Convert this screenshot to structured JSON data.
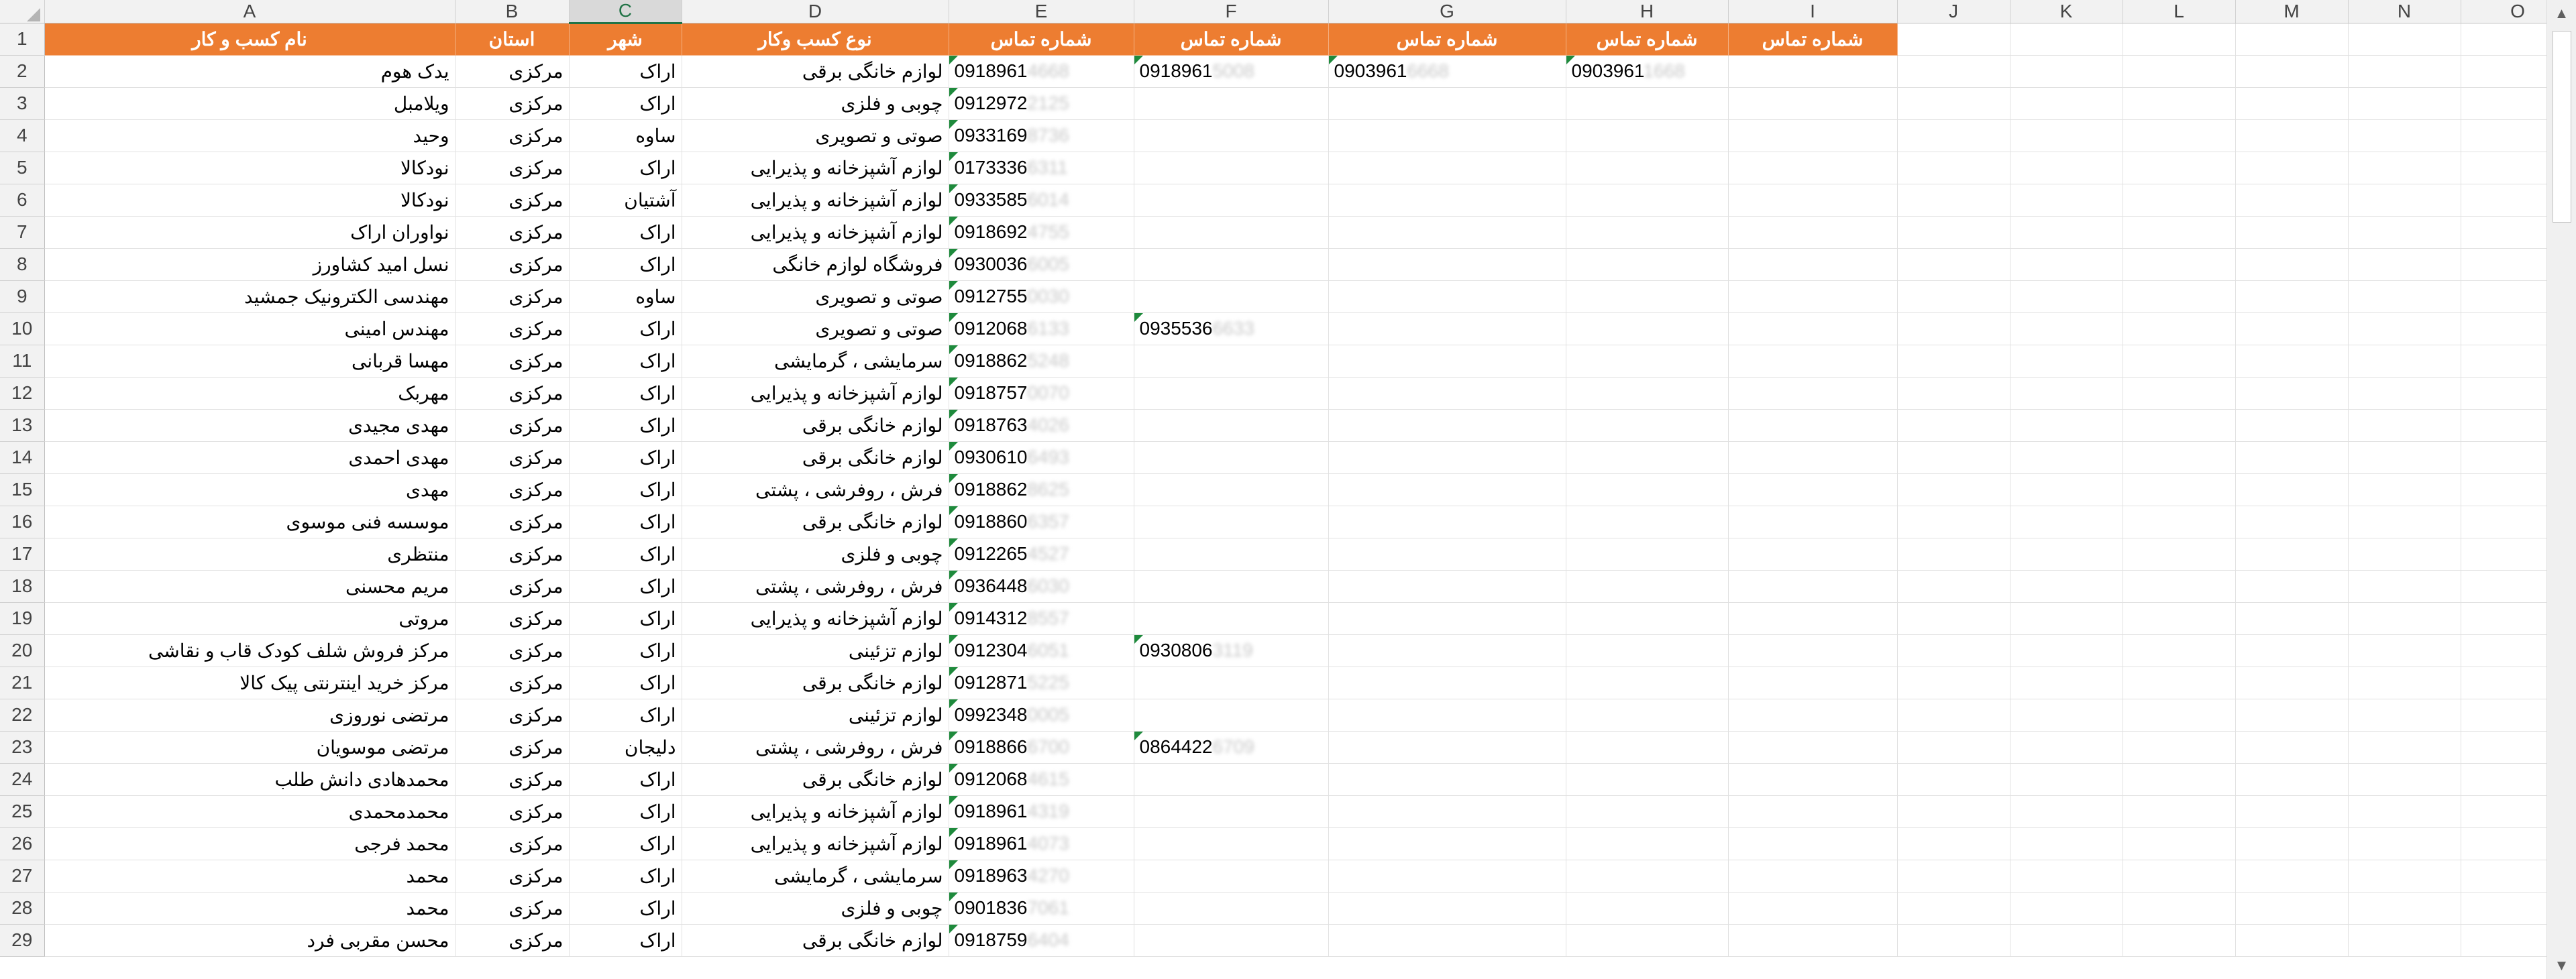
{
  "columns": [
    "A",
    "B",
    "C",
    "D",
    "E",
    "F",
    "G",
    "H",
    "I",
    "J",
    "K",
    "L",
    "M",
    "N",
    "O"
  ],
  "selected_column": "C",
  "header_row": {
    "A": "نام کسب و کار",
    "B": "استان",
    "C": "شهر",
    "D": "نوع کسب وکار",
    "E": "شماره تماس",
    "F": "شماره تماس",
    "G": "شماره تماس",
    "H": "شماره تماس",
    "I": "شماره تماس"
  },
  "rows": [
    {
      "num": "2",
      "name": "یدک هوم",
      "province": "مرکزی",
      "city": "اراک",
      "type": "لوازم خانگی برقی",
      "p1": "0918961",
      "p1h": "4668",
      "p2": "0918961",
      "p2h": "5008",
      "p3": "0903961",
      "p3h": "6668",
      "p4": "0903961",
      "p4h": "1668"
    },
    {
      "num": "3",
      "name": "ویلامبل",
      "province": "مرکزی",
      "city": "اراک",
      "type": "چوبی و فلزی",
      "p1": "0912972",
      "p1h": "2125"
    },
    {
      "num": "4",
      "name": "وحید",
      "province": "مرکزی",
      "city": "ساوه",
      "type": "صوتی و تصویری",
      "p1": "0933169",
      "p1h": "8736"
    },
    {
      "num": "5",
      "name": "نودکالا",
      "province": "مرکزی",
      "city": "اراک",
      "type": "لوازم آشپزخانه و پذیرایی",
      "p1": "0173336",
      "p1h": "6311"
    },
    {
      "num": "6",
      "name": "نودکالا",
      "province": "مرکزی",
      "city": "آشتیان",
      "type": "لوازم آشپزخانه و پذیرایی",
      "p1": "0933585",
      "p1h": "6014"
    },
    {
      "num": "7",
      "name": "نواوران اراک",
      "province": "مرکزی",
      "city": "اراک",
      "type": "لوازم آشپزخانه و پذیرایی",
      "p1": "0918692",
      "p1h": "4755"
    },
    {
      "num": "8",
      "name": "نسل امید کشاورز",
      "province": "مرکزی",
      "city": "اراک",
      "type": "فروشگاه لوازم خانگی",
      "p1": "0930036",
      "p1h": "6005"
    },
    {
      "num": "9",
      "name": "مهندسی الکترونیک جمشید",
      "province": "مرکزی",
      "city": "ساوه",
      "type": "صوتی و تصویری",
      "p1": "0912755",
      "p1h": "0030"
    },
    {
      "num": "10",
      "name": "مهندس امینی",
      "province": "مرکزی",
      "city": "اراک",
      "type": "صوتی و تصویری",
      "p1": "0912068",
      "p1h": "6133",
      "p2": "0935536",
      "p2h": "6633"
    },
    {
      "num": "11",
      "name": "مهسا قربانی",
      "province": "مرکزی",
      "city": "اراک",
      "type": "سرمایشی ، گرمایشی",
      "p1": "0918862",
      "p1h": "5248"
    },
    {
      "num": "12",
      "name": "مهربک",
      "province": "مرکزی",
      "city": "اراک",
      "type": "لوازم آشپزخانه و پذیرایی",
      "p1": "0918757",
      "p1h": "0070"
    },
    {
      "num": "13",
      "name": "مهدی مجیدی",
      "province": "مرکزی",
      "city": "اراک",
      "type": "لوازم خانگی برقی",
      "p1": "0918763",
      "p1h": "4026"
    },
    {
      "num": "14",
      "name": "مهدی احمدی",
      "province": "مرکزی",
      "city": "اراک",
      "type": "لوازم خانگی برقی",
      "p1": "0930610",
      "p1h": "6493"
    },
    {
      "num": "15",
      "name": "مهدی",
      "province": "مرکزی",
      "city": "اراک",
      "type": "فرش ، روفرشی ، پشتی",
      "p1": "0918862",
      "p1h": "8625"
    },
    {
      "num": "16",
      "name": "موسسه فنی موسوی",
      "province": "مرکزی",
      "city": "اراک",
      "type": "لوازم خانگی برقی",
      "p1": "0918860",
      "p1h": "6357"
    },
    {
      "num": "17",
      "name": "منتظری",
      "province": "مرکزی",
      "city": "اراک",
      "type": "چوبی و فلزی",
      "p1": "0912265",
      "p1h": "4527"
    },
    {
      "num": "18",
      "name": "مریم محسنی",
      "province": "مرکزی",
      "city": "اراک",
      "type": "فرش ، روفرشی ، پشتی",
      "p1": "0936448",
      "p1h": "6030"
    },
    {
      "num": "19",
      "name": "مروتی",
      "province": "مرکزی",
      "city": "اراک",
      "type": "لوازم آشپزخانه و پذیرایی",
      "p1": "0914312",
      "p1h": "8557"
    },
    {
      "num": "20",
      "name": "مرکز فروش شلف کودک قاب و نقاشی",
      "province": "مرکزی",
      "city": "اراک",
      "type": "لوازم تزئینی",
      "p1": "0912304",
      "p1h": "6051",
      "p2": "0930806",
      "p2h": "3119"
    },
    {
      "num": "21",
      "name": "مرکز خرید اینترنتی پیک کالا",
      "province": "مرکزی",
      "city": "اراک",
      "type": "لوازم خانگی برقی",
      "p1": "0912871",
      "p1h": "5225"
    },
    {
      "num": "22",
      "name": "مرتضی نوروزی",
      "province": "مرکزی",
      "city": "اراک",
      "type": "لوازم تزئینی",
      "p1": "0992348",
      "p1h": "0005"
    },
    {
      "num": "23",
      "name": "مرتضی موسویان",
      "province": "مرکزی",
      "city": "دلیجان",
      "type": "فرش ، روفرشی ، پشتی",
      "p1": "0918866",
      "p1h": "6700",
      "p2": "0864422",
      "p2h": "6709"
    },
    {
      "num": "24",
      "name": "محمدهادی دانش طلب",
      "province": "مرکزی",
      "city": "اراک",
      "type": "لوازم خانگی برقی",
      "p1": "0912068",
      "p1h": "4615"
    },
    {
      "num": "25",
      "name": "محمدمحمدی",
      "province": "مرکزی",
      "city": "اراک",
      "type": "لوازم آشپزخانه و پذیرایی",
      "p1": "0918961",
      "p1h": "4319"
    },
    {
      "num": "26",
      "name": "محمد فرجی",
      "province": "مرکزی",
      "city": "اراک",
      "type": "لوازم آشپزخانه و پذیرایی",
      "p1": "0918961",
      "p1h": "4073"
    },
    {
      "num": "27",
      "name": "محمد",
      "province": "مرکزی",
      "city": "اراک",
      "type": "سرمایشی ، گرمایشی",
      "p1": "0918963",
      "p1h": "4270"
    },
    {
      "num": "28",
      "name": "محمد",
      "province": "مرکزی",
      "city": "اراک",
      "type": "چوبی و فلزی",
      "p1": "0901836",
      "p1h": "7061"
    },
    {
      "num": "29",
      "name": "محسن مقربی فرد",
      "province": "مرکزی",
      "city": "اراک",
      "type": "لوازم خانگی برقی",
      "p1": "0918759",
      "p1h": "6404"
    }
  ],
  "colors": {
    "header_fill": "#ed7d31",
    "header_text": "#ffffff",
    "selected_col": "#217346",
    "flag": "#1e8a3c"
  },
  "icons": {
    "scroll_up": "triangle-up-icon",
    "scroll_down": "triangle-down-icon"
  }
}
